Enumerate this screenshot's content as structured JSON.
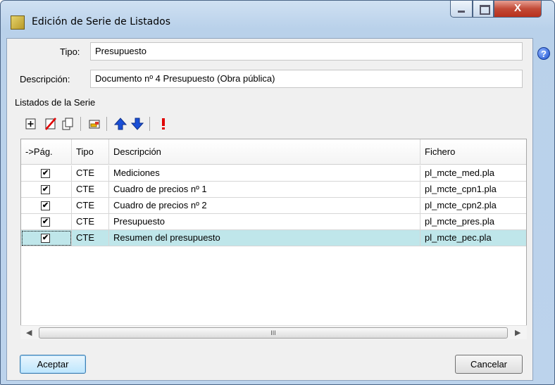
{
  "window": {
    "title": "Edición de Serie de Listados",
    "close_glyph": "X",
    "help_glyph": "?"
  },
  "form": {
    "tipo_label": "Tipo:",
    "tipo_value": "Presupuesto",
    "descripcion_label": "Descripción:",
    "descripcion_value": "Documento nº 4 Presupuesto (Obra pública)",
    "section_label": "Listados de la Serie"
  },
  "toolbar": {
    "icons": [
      "add-icon",
      "delete-icon",
      "copy-icon",
      "print-preview-icon",
      "move-up-icon",
      "move-down-icon",
      "exclamation-icon"
    ]
  },
  "grid": {
    "columns": [
      "->Pág.",
      "Tipo",
      "Descripción",
      "Fichero"
    ],
    "rows": [
      {
        "checked": true,
        "tipo": "CTE",
        "descripcion": "Mediciones",
        "fichero": "pl_mcte_med.pla"
      },
      {
        "checked": true,
        "tipo": "CTE",
        "descripcion": "Cuadro de precios nº 1",
        "fichero": "pl_mcte_cpn1.pla"
      },
      {
        "checked": true,
        "tipo": "CTE",
        "descripcion": "Cuadro de precios nº 2",
        "fichero": "pl_mcte_cpn2.pla"
      },
      {
        "checked": true,
        "tipo": "CTE",
        "descripcion": "Presupuesto",
        "fichero": "pl_mcte_pres.pla"
      },
      {
        "checked": true,
        "tipo": "CTE",
        "descripcion": "Resumen del presupuesto",
        "fichero": "pl_mcte_pec.pla",
        "selected": true
      }
    ],
    "check_glyph": "✔",
    "scroll_thumb_glyph": "III"
  },
  "buttons": {
    "accept": "Aceptar",
    "cancel": "Cancelar"
  },
  "colors": {
    "selected_row": "#bfe6ea",
    "up_arrow": "#1a4fd6",
    "warning": "#e00000"
  }
}
